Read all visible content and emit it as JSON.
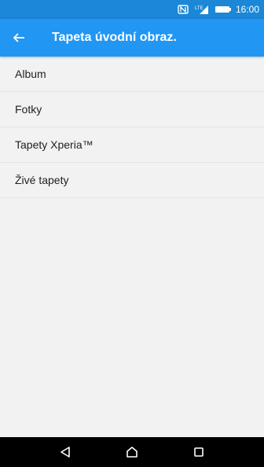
{
  "status_bar": {
    "time": "16:00",
    "icons": [
      "nfc-icon",
      "signal-icon",
      "battery-icon"
    ]
  },
  "app_bar": {
    "back_icon": "back-arrow-icon",
    "title": "Tapeta úvodní obraz."
  },
  "list": {
    "items": [
      {
        "label": "Album"
      },
      {
        "label": "Fotky"
      },
      {
        "label": "Tapety Xperia™"
      },
      {
        "label": "Živé tapety"
      }
    ]
  },
  "nav_bar": {
    "icons": [
      "back-nav-icon",
      "home-nav-icon",
      "recents-nav-icon"
    ]
  },
  "colors": {
    "status_bar": "#1b87d6",
    "app_bar": "#2196f3",
    "background": "#f2f2f2",
    "nav_bar": "#000000"
  }
}
